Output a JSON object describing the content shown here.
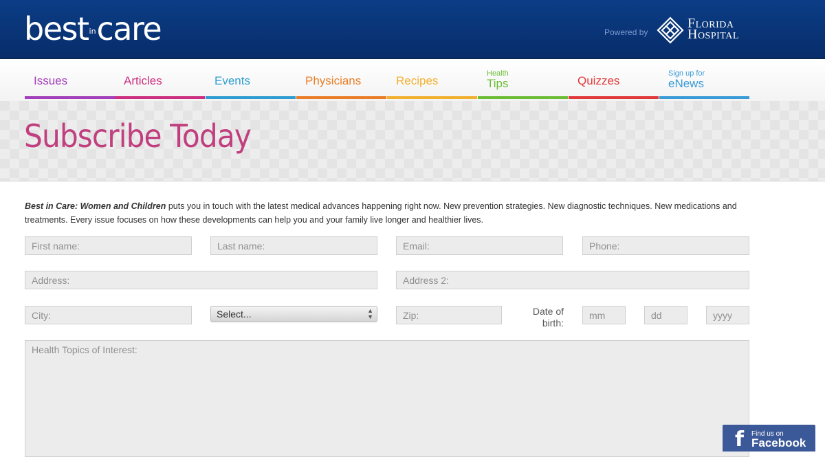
{
  "header": {
    "logo_left": "best",
    "logo_in": "in",
    "logo_right": "care",
    "powered_by": "Powered by",
    "brand_line1": "Florida",
    "brand_line2": "Hospital"
  },
  "nav": [
    {
      "label": "Issues",
      "color": "#a23fba"
    },
    {
      "label": "Articles",
      "color": "#cc2f7f"
    },
    {
      "label": "Events",
      "color": "#2f9dcf"
    },
    {
      "label": "Physicians",
      "color": "#ea7e26"
    },
    {
      "label": "Recipes",
      "color": "#f2b02f"
    },
    {
      "small": "Health",
      "big": "Tips",
      "color": "#6cbd36"
    },
    {
      "label": "Quizzes",
      "color": "#e0393a"
    },
    {
      "small": "Sign up for",
      "big": "eNews",
      "color": "#3a9bd6"
    }
  ],
  "hero": {
    "title": "Subscribe Today"
  },
  "intro": {
    "bold": "Best in Care: Women and Children",
    "text": " puts you in touch with the latest medical advances happening right now. New prevention strategies. New diagnostic techniques. New medications and treatments. Every issue focuses on how these developments can help you and your family live longer and healthier lives."
  },
  "form": {
    "first_name": "First name:",
    "last_name": "Last name:",
    "email": "Email:",
    "phone": "Phone:",
    "address": "Address:",
    "address2": "Address 2:",
    "city": "City:",
    "state_select": "Select...",
    "zip": "Zip:",
    "dob_label": "Date of birth:",
    "mm": "mm",
    "dd": "dd",
    "yyyy": "yyyy",
    "topics": "Health Topics of Interest:"
  },
  "facebook": {
    "line1": "Find us on",
    "line2": "Facebook",
    "glyph": "f"
  }
}
